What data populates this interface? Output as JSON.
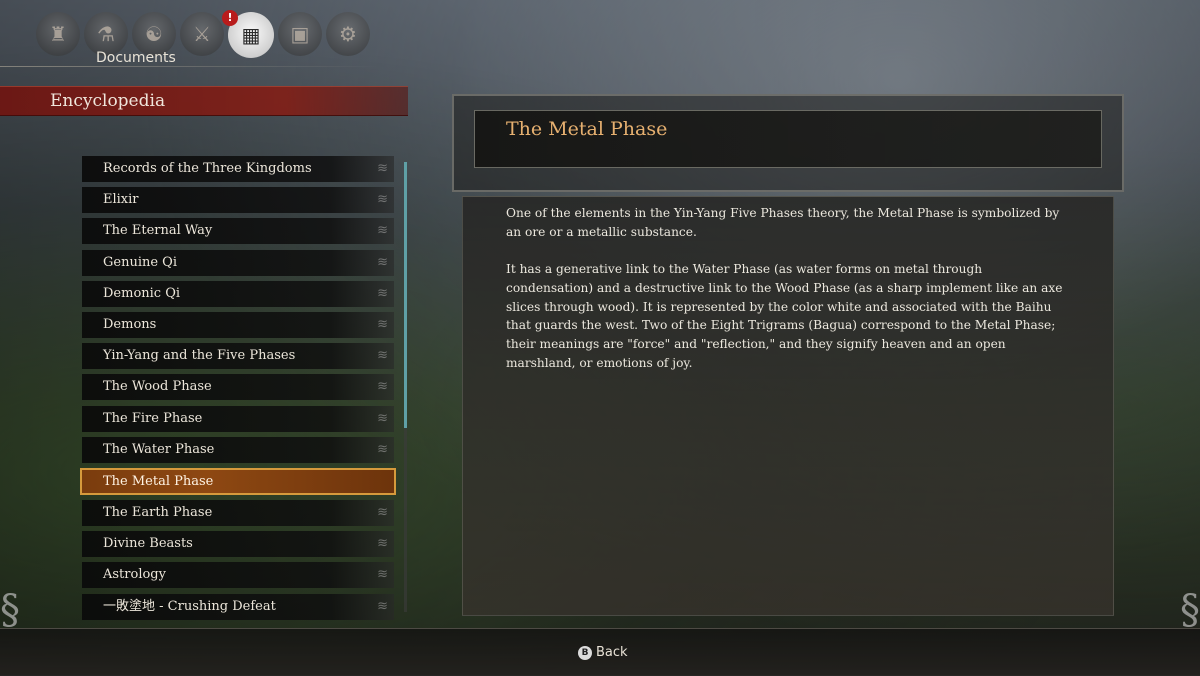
{
  "top_menu": {
    "icons": [
      "warrior-icon",
      "flask-icon",
      "meditation-icon",
      "sword-icon",
      "documents-icon",
      "map-icon",
      "gear-icon"
    ],
    "active_label": "Documents",
    "badge": "!"
  },
  "category": {
    "title": "Encyclopedia"
  },
  "list": {
    "items": [
      "Records of the Three Kingdoms",
      "Elixir",
      "The Eternal Way",
      "Genuine Qi",
      "Demonic Qi",
      "Demons",
      "Yin-Yang and the Five Phases",
      "The Wood Phase",
      "The Fire Phase",
      "The Water Phase",
      "The Metal Phase",
      "The Earth Phase",
      "Divine Beasts",
      "Astrology",
      "一敗塗地 - Crushing Defeat"
    ],
    "selected": "The Metal Phase"
  },
  "entry": {
    "title": "The Metal Phase",
    "paragraph1": "One of the elements in the Yin-Yang Five Phases theory, the Metal Phase is symbolized by an ore or a metallic substance.",
    "paragraph2": "It has a generative link to the Water Phase (as water forms on metal through condensation) and a destructive link to the Wood Phase (as a sharp implement like an axe slices through wood). It is represented by the color white and associated with the Baihu that guards the west. Two of the Eight Trigrams (Bagua) correspond to the Metal Phase; their meanings are \"force\" and \"reflection,\" and they signify heaven and an open marshland, or emotions of joy."
  },
  "footer": {
    "back_key": "B",
    "back_label": "Back"
  },
  "colors": {
    "selected_border": "#d69a3c",
    "header_red": "#6e1612",
    "title_gold": "#e6b070",
    "scroll_thumb": "#5fa0a6"
  },
  "scroll_position": 0.0
}
